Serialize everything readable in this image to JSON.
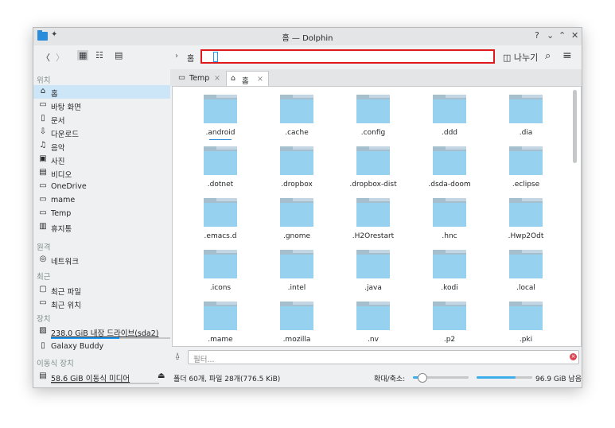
{
  "window": {
    "title": "홈 — Dolphin",
    "help": "?",
    "minimize": "⌄",
    "maximize": "⌃",
    "close": "✕"
  },
  "toolbar": {
    "back": "〈",
    "forward": "〉",
    "view_icons": "▦",
    "view_compact": "☷",
    "view_details": "▤",
    "breadcrumb_arrow": "›",
    "breadcrumb_home": "홈",
    "split_label": "나누기",
    "search": "⌕",
    "menu": "≡"
  },
  "sidebar": {
    "sections": [
      "위치",
      "원격",
      "최근",
      "장치",
      "이동식 장치"
    ],
    "places": [
      {
        "icon": "home-icon",
        "glyph": "⌂",
        "label": "홈"
      },
      {
        "icon": "desktop-icon",
        "glyph": "▭",
        "label": "바탕 화면"
      },
      {
        "icon": "document-icon",
        "glyph": "▯",
        "label": "문서"
      },
      {
        "icon": "download-icon",
        "glyph": "⇩",
        "label": "다운로드"
      },
      {
        "icon": "music-icon",
        "glyph": "♫",
        "label": "음악"
      },
      {
        "icon": "picture-icon",
        "glyph": "▣",
        "label": "사진"
      },
      {
        "icon": "video-icon",
        "glyph": "▤",
        "label": "비디오"
      },
      {
        "icon": "folder-icon",
        "glyph": "▭",
        "label": "OneDrive"
      },
      {
        "icon": "folder-icon",
        "glyph": "▭",
        "label": "mame"
      },
      {
        "icon": "folder-icon",
        "glyph": "▭",
        "label": "Temp"
      },
      {
        "icon": "trash-icon",
        "glyph": "▥",
        "label": "휴지통"
      }
    ],
    "remote": [
      {
        "icon": "network-icon",
        "glyph": "◎",
        "label": "네트워크"
      }
    ],
    "recent": [
      {
        "icon": "recent-files-icon",
        "glyph": "▢",
        "label": "최근 파일"
      },
      {
        "icon": "recent-locations-icon",
        "glyph": "▭",
        "label": "최근 위치"
      }
    ],
    "devices": [
      {
        "icon": "drive-icon",
        "glyph": "▨",
        "label": "238.0 GiB 내장 드라이브(sda2)"
      },
      {
        "icon": "phone-icon",
        "glyph": "▯",
        "label": "Galaxy Buddy"
      }
    ],
    "removable": [
      {
        "icon": "usb-icon",
        "glyph": "▤",
        "label": "58.6 GiB 이동식 미디어",
        "eject": "⏏"
      }
    ]
  },
  "tabs": [
    {
      "icon": "folder-icon",
      "glyph": "▭",
      "label": "Temp",
      "close": "×"
    },
    {
      "icon": "home-icon",
      "glyph": "⌂",
      "label": "홈",
      "close": "×"
    }
  ],
  "folders": [
    ".android",
    ".cache",
    ".config",
    ".ddd",
    ".dia",
    ".dotnet",
    ".dropbox",
    ".dropbox-dist",
    ".dsda-doom",
    ".eclipse",
    ".emacs.d",
    ".gnome",
    ".H2Orestart",
    ".hnc",
    ".Hwp2Odt",
    ".icons",
    ".intel",
    ".java",
    ".kodi",
    ".local",
    ".mame",
    ".mozilla",
    ".nv",
    ".p2",
    ".pki"
  ],
  "filter": {
    "icon": "filter-icon",
    "glyph": "⍙",
    "placeholder": "필터..."
  },
  "status": {
    "summary": "폴더 60개, 파일 28개(776.5 KiB)",
    "zoom_label": "확대/축소:",
    "zoom_level": 0.15,
    "free_fill": 0.7,
    "free_space": "96.9 GiB 남음"
  },
  "colors": {
    "accent": "#1d99f3",
    "highlight": "#cce6f8",
    "folder": "#96d1f0",
    "annotation": "#e0191c"
  }
}
